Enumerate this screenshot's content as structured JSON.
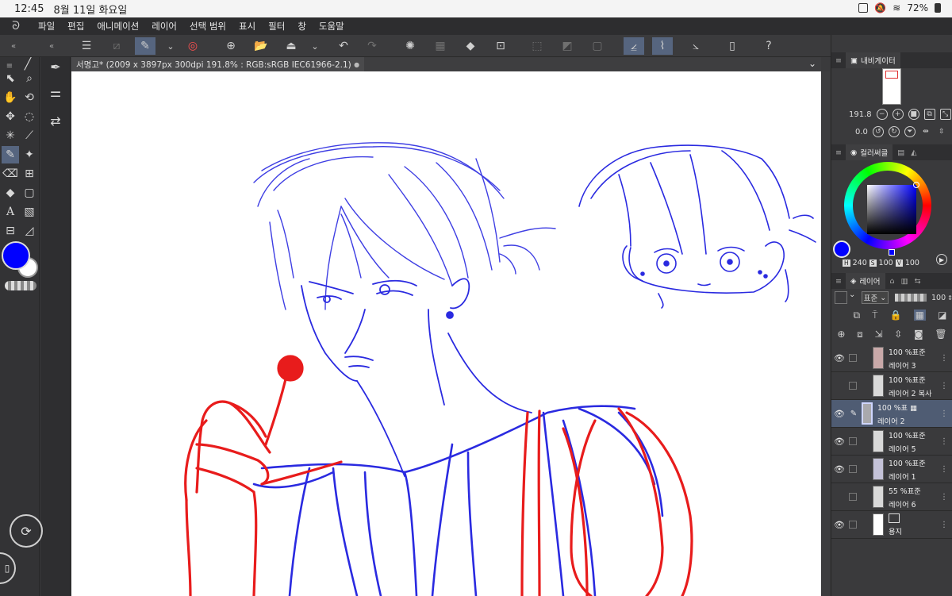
{
  "status_bar": {
    "time": "12:45",
    "date": "8월 11일 화요일",
    "battery": "72%"
  },
  "menu": {
    "items": [
      "파일",
      "편집",
      "애니메이션",
      "레이어",
      "선택 범위",
      "표시",
      "필터",
      "창",
      "도움말"
    ]
  },
  "document": {
    "tab_title": "서명고* (2009 x 3897px 300dpi 191.8% : RGB:sRGB IEC61966-2.1)",
    "tab_dot": "●"
  },
  "tool_colors": {
    "main": "#0000ff",
    "sub": "#ffffff"
  },
  "navigator": {
    "title": "내비게이터",
    "zoom": "191.8",
    "rotation": "0.0"
  },
  "color_panel": {
    "title": "컬러써클",
    "h_label": "H",
    "h": "240",
    "s_label": "S",
    "s": "100",
    "v_label": "V",
    "v": "100",
    "current_color": "#0000ff"
  },
  "layer_panel": {
    "title": "레이어",
    "blend_mode": "표준",
    "opacity": "100",
    "layers": [
      {
        "opacity": "100 %",
        "mode": "표준",
        "name": "레이어 3",
        "visible": true
      },
      {
        "opacity": "100 %",
        "mode": "표준",
        "name": "레이어 2 복사",
        "visible": false
      },
      {
        "opacity": "100 %",
        "mode": "표",
        "name": "레이어 2",
        "visible": true,
        "selected": true
      },
      {
        "opacity": "100 %",
        "mode": "표준",
        "name": "레이어 5",
        "visible": true
      },
      {
        "opacity": "100 %",
        "mode": "표준",
        "name": "레이어 1",
        "visible": true
      },
      {
        "opacity": "55 %",
        "mode": "표준",
        "name": "레이어 6",
        "visible": false
      },
      {
        "opacity": "",
        "mode": "",
        "name": "용지",
        "visible": true
      }
    ]
  },
  "colors": {
    "sketch_blue": "#2a2ae0",
    "sketch_red": "#e81c1c",
    "accent": "#56657f"
  }
}
